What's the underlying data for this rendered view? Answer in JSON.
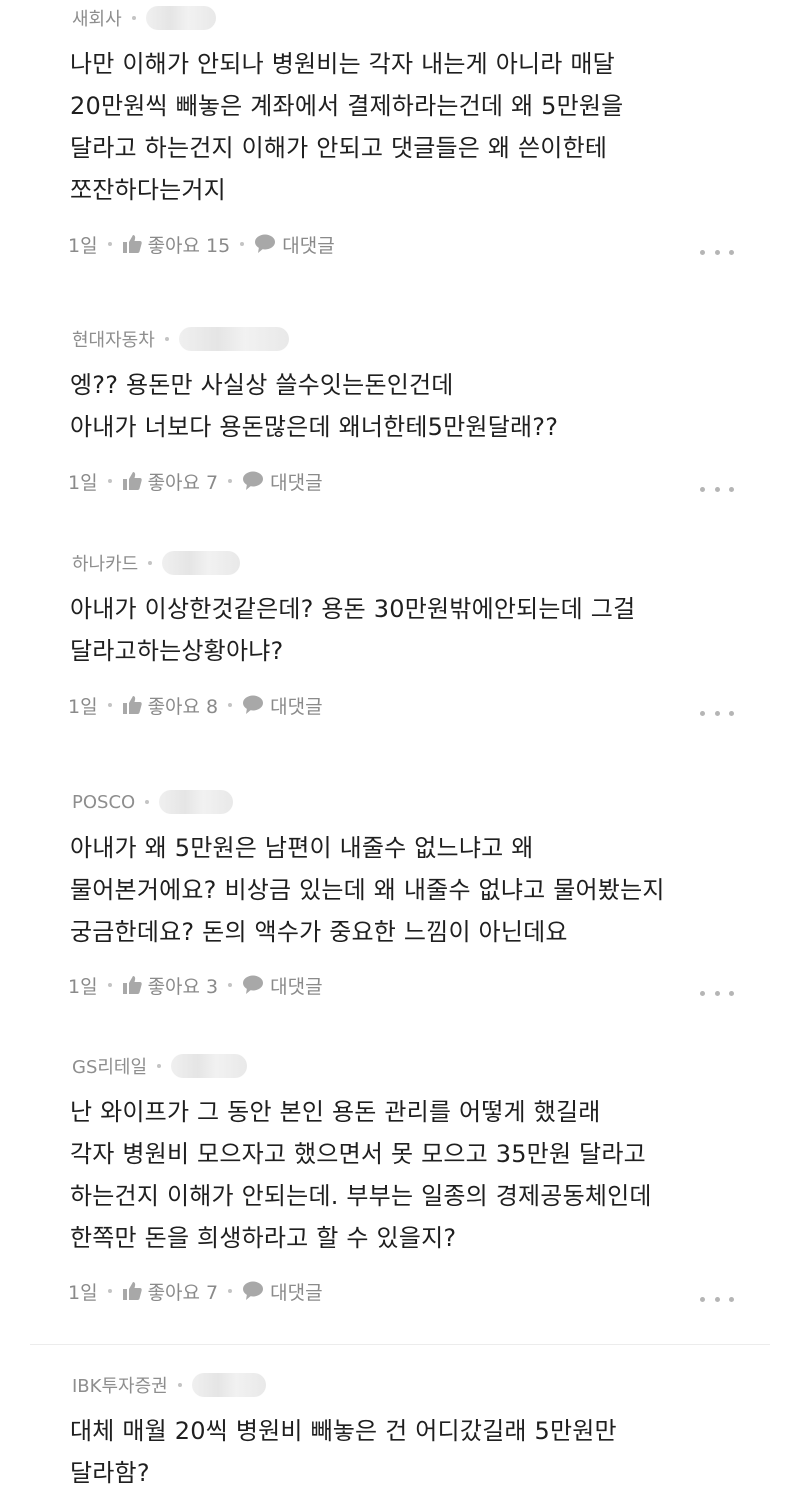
{
  "comments": [
    {
      "author": "새회사",
      "lines": [
        "나만 이해가 안되나 병원비는 각자 내는게 아니라 매달",
        "20만원씩 빼놓은 계좌에서 결제하라는건데 왜 5만원을",
        "달라고 하는건지 이해가 안되고 댓글들은 왜 쓴이한테",
        "쪼잔하다는거지"
      ],
      "time": "1일",
      "like_label": "좋아요 15",
      "reply_label": "대댓글"
    },
    {
      "author": "현대자동차",
      "lines": [
        "엥?? 용돈만 사실상 쓸수잇는돈인건데",
        "아내가 너보다 용돈많은데 왜너한테5만원달래??"
      ],
      "time": "1일",
      "like_label": "좋아요 7",
      "reply_label": "대댓글"
    },
    {
      "author": "하나카드",
      "lines": [
        "아내가 이상한것같은데? 용돈 30만원밖에안되는데 그걸",
        "달라고하는상황아냐?"
      ],
      "time": "1일",
      "like_label": "좋아요 8",
      "reply_label": "대댓글"
    },
    {
      "author": "POSCO",
      "lines": [
        "아내가 왜 5만원은 남편이 내줄수 없느냐고 왜",
        "물어본거에요? 비상금 있는데 왜 내줄수 없냐고 물어봤는지",
        "궁금한데요? 돈의 액수가 중요한 느낌이 아닌데요"
      ],
      "time": "1일",
      "like_label": "좋아요 3",
      "reply_label": "대댓글"
    },
    {
      "author": "GS리테일",
      "lines": [
        "난 와이프가 그 동안 본인 용돈 관리를 어떻게 했길래",
        "각자 병원비 모으자고 했으면서 못 모으고 35만원 달라고",
        "하는건지 이해가 안되는데. 부부는 일종의 경제공동체인데",
        "한쪽만 돈을 희생하라고 할 수 있을지?"
      ],
      "time": "1일",
      "like_label": "좋아요 7",
      "reply_label": "대댓글"
    },
    {
      "author": "IBK투자증권",
      "lines": [
        "대체 매월 20씩 병원비 빼놓은 건 어디갔길래 5만원만",
        "달라함?"
      ]
    }
  ],
  "icons": {
    "like": "thumbs-up-icon",
    "reply": "speech-bubble-icon",
    "more": "more-dots-icon"
  },
  "colors": {
    "meta_text": "#8e8e8e",
    "body_text": "#1f1f1f",
    "icon": "#a8a8a8"
  }
}
